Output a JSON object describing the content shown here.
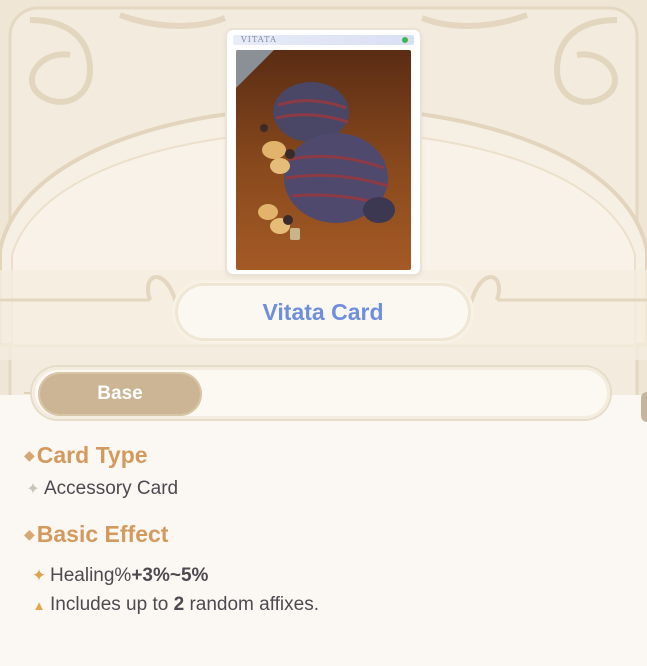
{
  "card": {
    "brand": "VITATA",
    "title": "Vitata Card"
  },
  "tabs": [
    {
      "label": "Base",
      "selected": true
    }
  ],
  "details": {
    "card_type_heading": "Card Type",
    "card_type_value": "Accessory Card",
    "basic_effect_heading": "Basic Effect",
    "effects": [
      {
        "prefix": "Healing% ",
        "highlight": "+3%~5%",
        "suffix": ""
      },
      {
        "prefix": "Includes up to ",
        "highlight": "2",
        "suffix": " random affixes."
      }
    ]
  },
  "icons": {
    "section_bullet": "diamond-icon",
    "card_type_bullet": "sparkle-icon",
    "effect_bullet_1": "star-icon",
    "effect_bullet_2": "triangle-icon"
  },
  "colors": {
    "title": "#6f8fdc",
    "section_heading": "#d39a5f",
    "tab_selected_bg": "#cbb594",
    "body_text": "#4c4a50"
  }
}
